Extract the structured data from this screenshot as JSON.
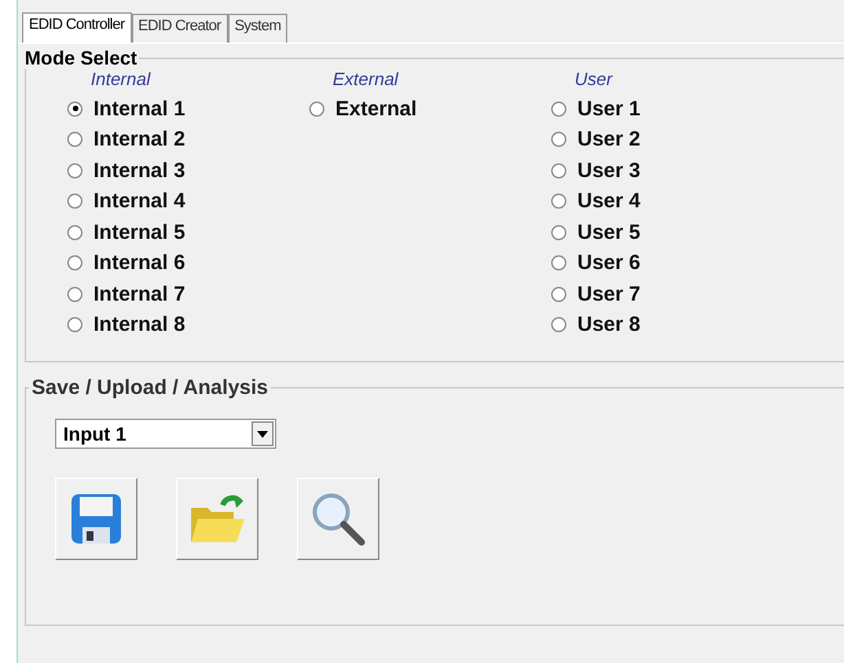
{
  "tabs": [
    {
      "label": "EDID Controller",
      "selected": true
    },
    {
      "label": "EDID Creator",
      "selected": false
    },
    {
      "label": "System",
      "selected": false
    }
  ],
  "mode_select": {
    "title": "Mode Select",
    "columns": [
      {
        "header": "Internal",
        "options": [
          {
            "label": "Internal 1",
            "selected": true
          },
          {
            "label": "Internal 2",
            "selected": false
          },
          {
            "label": "Internal 3",
            "selected": false
          },
          {
            "label": "Internal 4",
            "selected": false
          },
          {
            "label": "Internal 5",
            "selected": false
          },
          {
            "label": "Internal 6",
            "selected": false
          },
          {
            "label": "Internal 7",
            "selected": false
          },
          {
            "label": "Internal 8",
            "selected": false
          }
        ]
      },
      {
        "header": "External",
        "options": [
          {
            "label": "External",
            "selected": false
          }
        ]
      },
      {
        "header": "User",
        "options": [
          {
            "label": "User 1",
            "selected": false
          },
          {
            "label": "User 2",
            "selected": false
          },
          {
            "label": "User 3",
            "selected": false
          },
          {
            "label": "User 4",
            "selected": false
          },
          {
            "label": "User 5",
            "selected": false
          },
          {
            "label": "User 6",
            "selected": false
          },
          {
            "label": "User 7",
            "selected": false
          },
          {
            "label": "User 8",
            "selected": false
          }
        ]
      }
    ]
  },
  "save_upload": {
    "title": "Save / Upload / Analysis",
    "input_select": {
      "value": "Input 1"
    },
    "buttons": [
      {
        "kind": "save"
      },
      {
        "kind": "open"
      },
      {
        "kind": "analyze"
      }
    ]
  }
}
